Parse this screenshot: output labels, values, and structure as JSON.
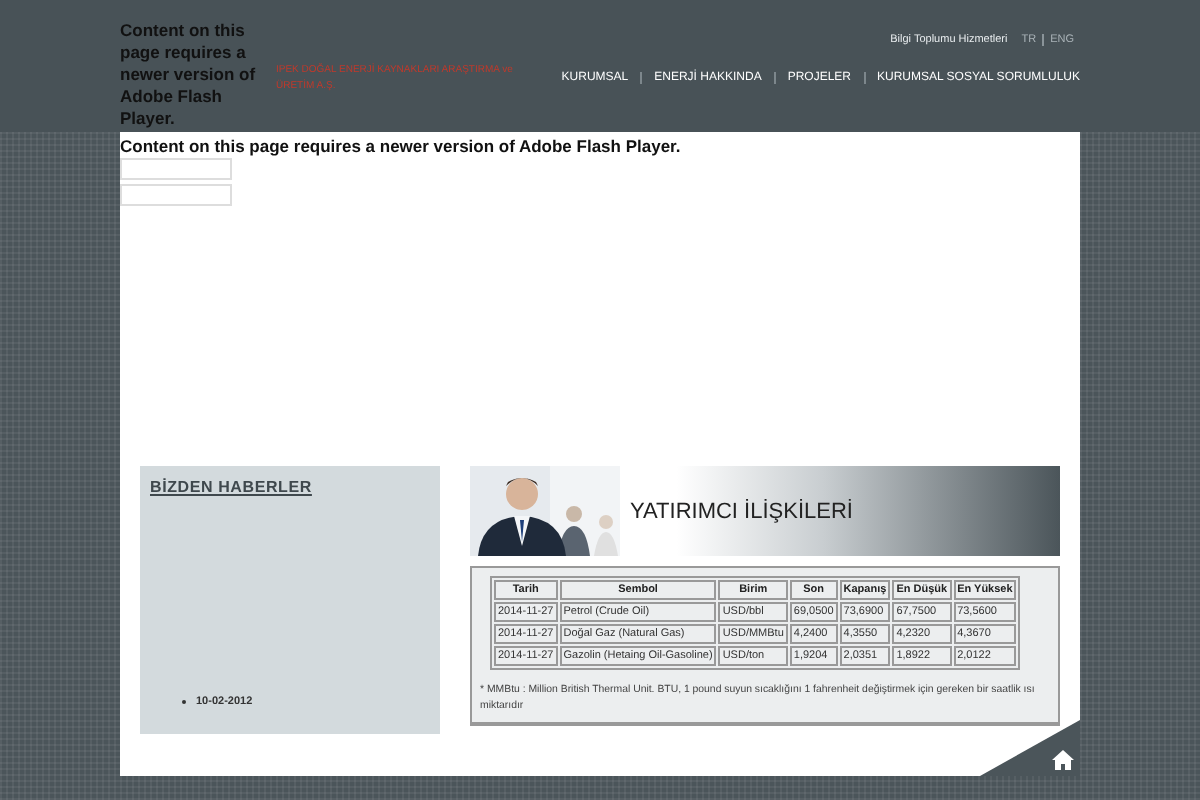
{
  "header": {
    "flash_notice": "Content on this page requires a newer version of Adobe Flash Player.",
    "company": "IPEK DOĞAL ENERJİ KAYNAKLARI ARAŞTIRMA ve ÜRETİM A.Ş.",
    "top_links": [
      {
        "label": "Bilgi Toplumu Hizmetleri",
        "kind": "link"
      },
      {
        "label": "TR",
        "kind": "lang"
      },
      {
        "label": "ENG",
        "kind": "lang"
      }
    ],
    "nav": [
      {
        "label": "KURUMSAL"
      },
      {
        "label": "ENERJİ HAKKINDA"
      },
      {
        "label": "PROJELER"
      },
      {
        "label": "KURUMSAL SOSYAL SORUMLULUK"
      }
    ]
  },
  "flash_notice": "Content on this page requires a newer version of Adobe Flash Player.",
  "news": {
    "title": "BİZDEN HABERLER",
    "items": [
      {
        "date": "10-02-2012"
      }
    ]
  },
  "investor": {
    "title": "YATIRIMCI İLİŞKİLERİ",
    "columns": [
      "Tarih",
      "Sembol",
      "Birim",
      "Son",
      "Kapanış",
      "En Düşük",
      "En Yüksek"
    ],
    "rows": [
      [
        "2014-11-27",
        "Petrol (Crude Oil)",
        "USD/bbl",
        "69,0500",
        "73,6900",
        "67,7500",
        "73,5600"
      ],
      [
        "2014-11-27",
        "Doğal Gaz (Natural Gas)",
        "USD/MMBtu",
        "4,2400",
        "4,3550",
        "4,2320",
        "4,3670"
      ],
      [
        "2014-11-27",
        "Gazolin (Hetaing Oil-Gasoline)",
        "USD/ton",
        "1,9204",
        "2,0351",
        "1,8922",
        "2,0122"
      ]
    ],
    "footnote": "* MMBtu : Million British Thermal Unit. BTU, 1 pound suyun sıcaklığını 1 fahrenheit değiştirmek için gereken bir saatlik ısı miktarıdır"
  }
}
